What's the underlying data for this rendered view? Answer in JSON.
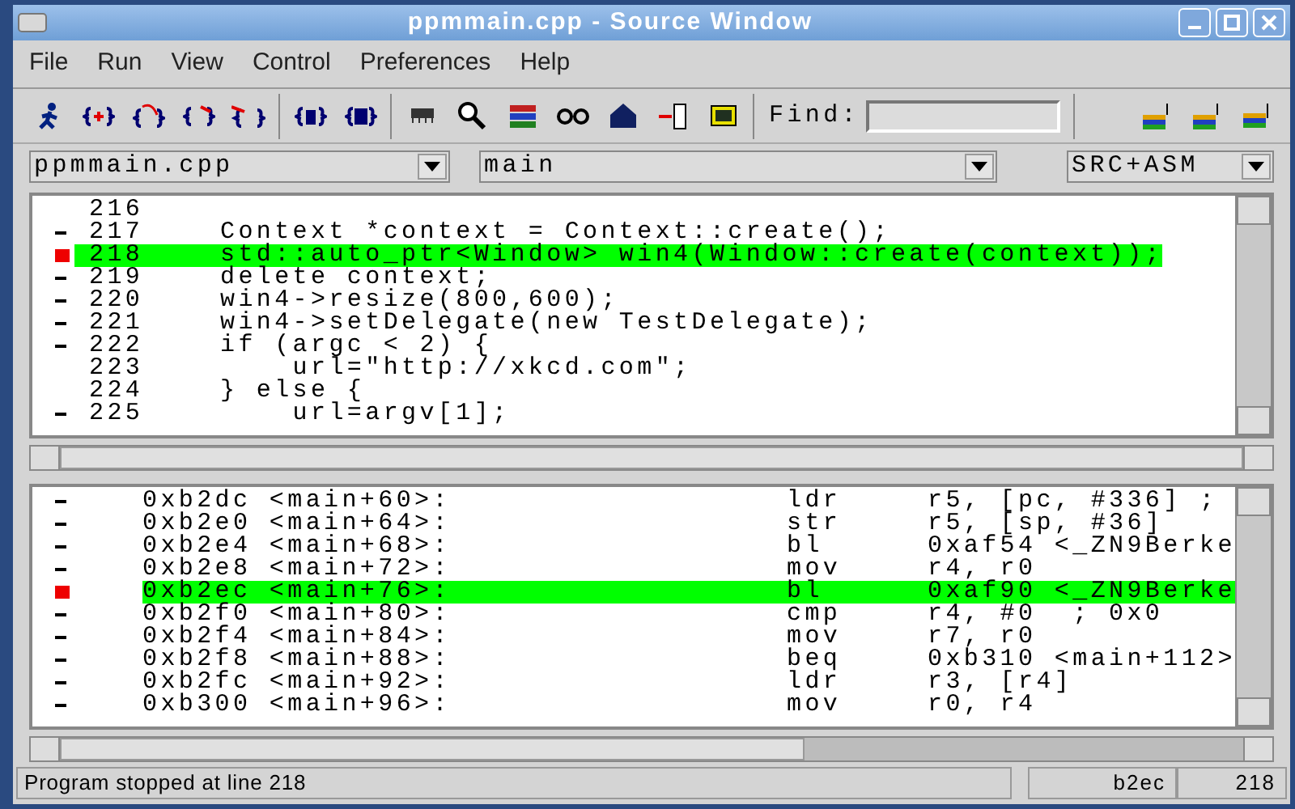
{
  "window": {
    "title": "ppmmain.cpp - Source Window"
  },
  "menu": [
    "File",
    "Run",
    "View",
    "Control",
    "Preferences",
    "Help"
  ],
  "find": {
    "label": "Find:"
  },
  "selectors": {
    "file": "ppmmain.cpp",
    "function": "main",
    "mode": "SRC+ASM"
  },
  "source_lines": [
    {
      "breakpoint": false,
      "number": "216",
      "current": false
    },
    {
      "breakpoint": false,
      "executable": true,
      "number": "217",
      "code": "Context *context = Context::create();",
      "current": false
    },
    {
      "breakpoint": true,
      "number": "218",
      "code": "std::auto_ptr<Window> win4(Window::create(context));",
      "current": true
    },
    {
      "breakpoint": false,
      "executable": true,
      "number": "219",
      "code": "delete context;",
      "current": false
    },
    {
      "breakpoint": false,
      "executable": true,
      "number": "220",
      "code": "win4->resize(800,600);",
      "current": false
    },
    {
      "breakpoint": false,
      "executable": true,
      "number": "221",
      "code": "win4->setDelegate(new TestDelegate);",
      "current": false
    },
    {
      "breakpoint": false,
      "executable": true,
      "number": "222",
      "code": "if (argc < 2) {",
      "current": false
    },
    {
      "breakpoint": false,
      "number": "223",
      "code": "    url=\"http://xkcd.com\";",
      "current": false
    },
    {
      "breakpoint": false,
      "number": "224",
      "code": "} else {",
      "current": false
    },
    {
      "breakpoint": false,
      "executable": true,
      "number": "225",
      "code": "    url=argv[1];",
      "current": false
    }
  ],
  "asm_lines": [
    {
      "breakpoint": false,
      "executable": true,
      "address": "0xb2dc <main+60>:",
      "op": "ldr",
      "args": "r5, [pc, #336] ;",
      "current": false
    },
    {
      "breakpoint": false,
      "executable": true,
      "address": "0xb2e0 <main+64>:",
      "op": "str",
      "args": "r5, [sp, #36]",
      "current": false
    },
    {
      "breakpoint": false,
      "executable": true,
      "address": "0xb2e4 <main+68>:",
      "op": "bl",
      "args": "0xaf54 <_ZN9Berke",
      "current": false
    },
    {
      "breakpoint": false,
      "executable": true,
      "address": "0xb2e8 <main+72>:",
      "op": "mov",
      "args": "r4, r0",
      "current": false
    },
    {
      "breakpoint": true,
      "address": "0xb2ec <main+76>:",
      "op": "bl",
      "args": "0xaf90 <_ZN9Berke",
      "current": true
    },
    {
      "breakpoint": false,
      "executable": true,
      "address": "0xb2f0 <main+80>:",
      "op": "cmp",
      "args": "r4, #0  ; 0x0",
      "current": false
    },
    {
      "breakpoint": false,
      "executable": true,
      "address": "0xb2f4 <main+84>:",
      "op": "mov",
      "args": "r7, r0",
      "current": false
    },
    {
      "breakpoint": false,
      "executable": true,
      "address": "0xb2f8 <main+88>:",
      "op": "beq",
      "args": "0xb310 <main+112>",
      "current": false
    },
    {
      "breakpoint": false,
      "executable": true,
      "address": "0xb2fc <main+92>:",
      "op": "ldr",
      "args": "r3, [r4]",
      "current": false
    },
    {
      "breakpoint": false,
      "executable": true,
      "address": "0xb300 <main+96>:",
      "op": "mov",
      "args": "r0, r4",
      "current": false
    }
  ],
  "status_bar": {
    "message": "Program stopped at line 218",
    "address": "b2ec",
    "line": "218"
  }
}
